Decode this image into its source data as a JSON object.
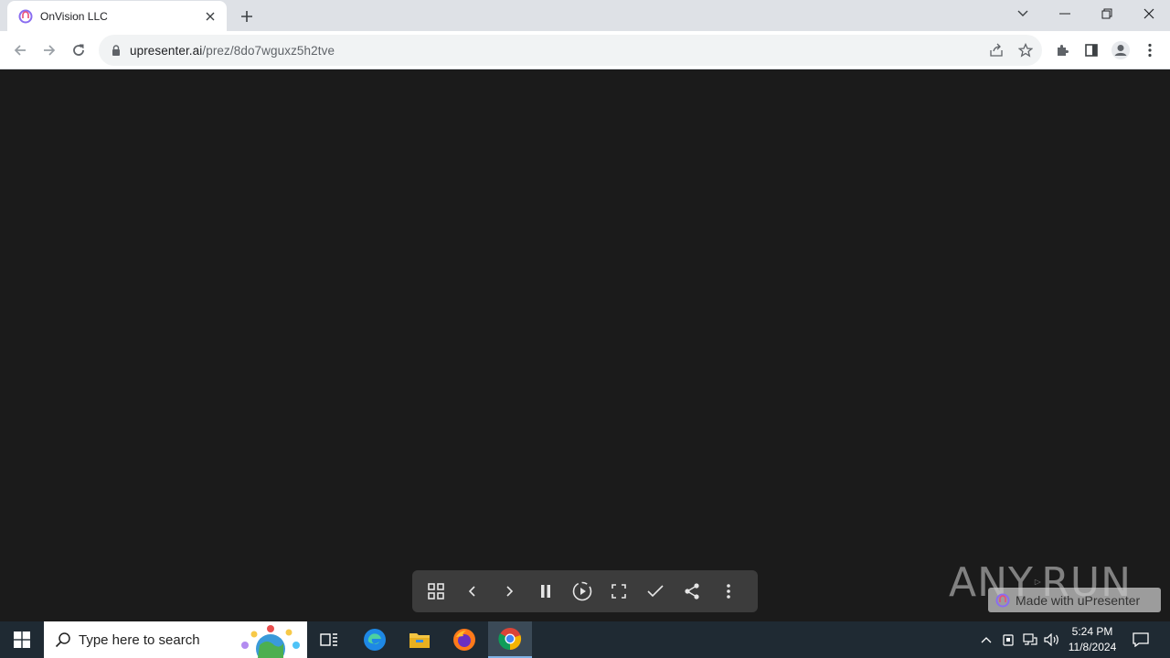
{
  "browser": {
    "tab_title": "OnVision LLC",
    "url_host": "upresenter.ai",
    "url_path": "/prez/8do7wguxz5h2tve"
  },
  "presentation": {
    "controls": [
      "grid-view",
      "previous",
      "next",
      "pause",
      "replay",
      "fullscreen",
      "mark-complete",
      "share",
      "more"
    ],
    "badge_label": "Made with uPresenter"
  },
  "watermark": {
    "text_left": "ANY",
    "text_right": "RUN"
  },
  "taskbar": {
    "search_placeholder": "Type here to search",
    "time": "5:24 PM",
    "date": "11/8/2024"
  },
  "colors": {
    "content_bg": "#1b1b1b",
    "taskbar_bg": "#1f2a33",
    "tabstrip_bg": "#dee1e6"
  }
}
